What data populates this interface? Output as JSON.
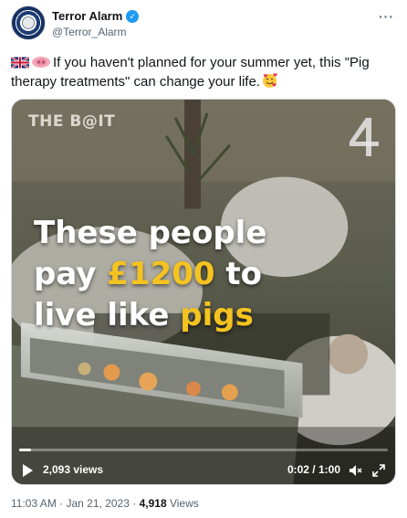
{
  "account": {
    "name": "Terror Alarm",
    "handle": "@Terror_Alarm",
    "verified_icon": "verified-badge-icon",
    "avatar_icon": "terror-alarm-logo"
  },
  "tweet": {
    "emoji_icons": [
      "uk-flag-icon",
      "pig-nose-icon"
    ],
    "text": "If you haven't planned for your summer yet, this \"Pig therapy treatments\" can change your life.",
    "trailing_icon": "smiling-face-with-hearts-icon"
  },
  "video": {
    "watermark": "THE B@IT",
    "channel_logo_icon": "channel-4-logo",
    "caption_lines": [
      {
        "before": "These people",
        "highlight": "",
        "after": ""
      },
      {
        "before": "pay ",
        "highlight": "£1200",
        "after": " to"
      },
      {
        "before": "live like ",
        "highlight": "pigs",
        "after": ""
      }
    ],
    "highlight_color": "#f5c320",
    "views": "2,093 views",
    "time": "0:02 / 1:00",
    "progress_fraction": 0.033
  },
  "meta": {
    "time": "11:03 AM",
    "separator": "·",
    "date": "Jan 21, 2023",
    "views_count": "4,918",
    "views_label": "Views"
  },
  "colors": {
    "accent": "#1d9bf0",
    "text": "#0f1419",
    "muted": "#536471"
  }
}
